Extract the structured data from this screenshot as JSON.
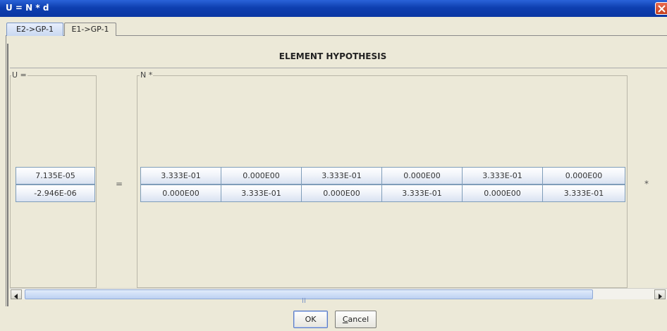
{
  "window": {
    "title": "U = N * d"
  },
  "tabs": [
    {
      "label": "E2->GP-1",
      "active": true
    },
    {
      "label": "E1->GP-1",
      "active": false
    }
  ],
  "header": {
    "title": "ELEMENT HYPOTHESIS"
  },
  "u_group": {
    "label": "U =",
    "values": [
      "7.135E-05",
      "-2.946E-06"
    ]
  },
  "equals_sign": "=",
  "n_group": {
    "label": "N *",
    "rows": [
      [
        "3.333E-01",
        "0.000E00",
        "3.333E-01",
        "0.000E00",
        "3.333E-01",
        "0.000E00"
      ],
      [
        "0.000E00",
        "3.333E-01",
        "0.000E00",
        "3.333E-01",
        "0.000E00",
        "3.333E-01"
      ]
    ]
  },
  "multiply_sign": "*",
  "buttons": {
    "ok": "OK",
    "cancel_mnemonic": "C",
    "cancel_rest": "ancel"
  },
  "colors": {
    "titlebar": "#0e3fb0",
    "close": "#c6401f",
    "cell_border": "#7f9db9"
  },
  "icons": [
    "close-icon",
    "scroll-left-arrow-icon",
    "scroll-right-arrow-icon",
    "scroll-grip-icon"
  ]
}
